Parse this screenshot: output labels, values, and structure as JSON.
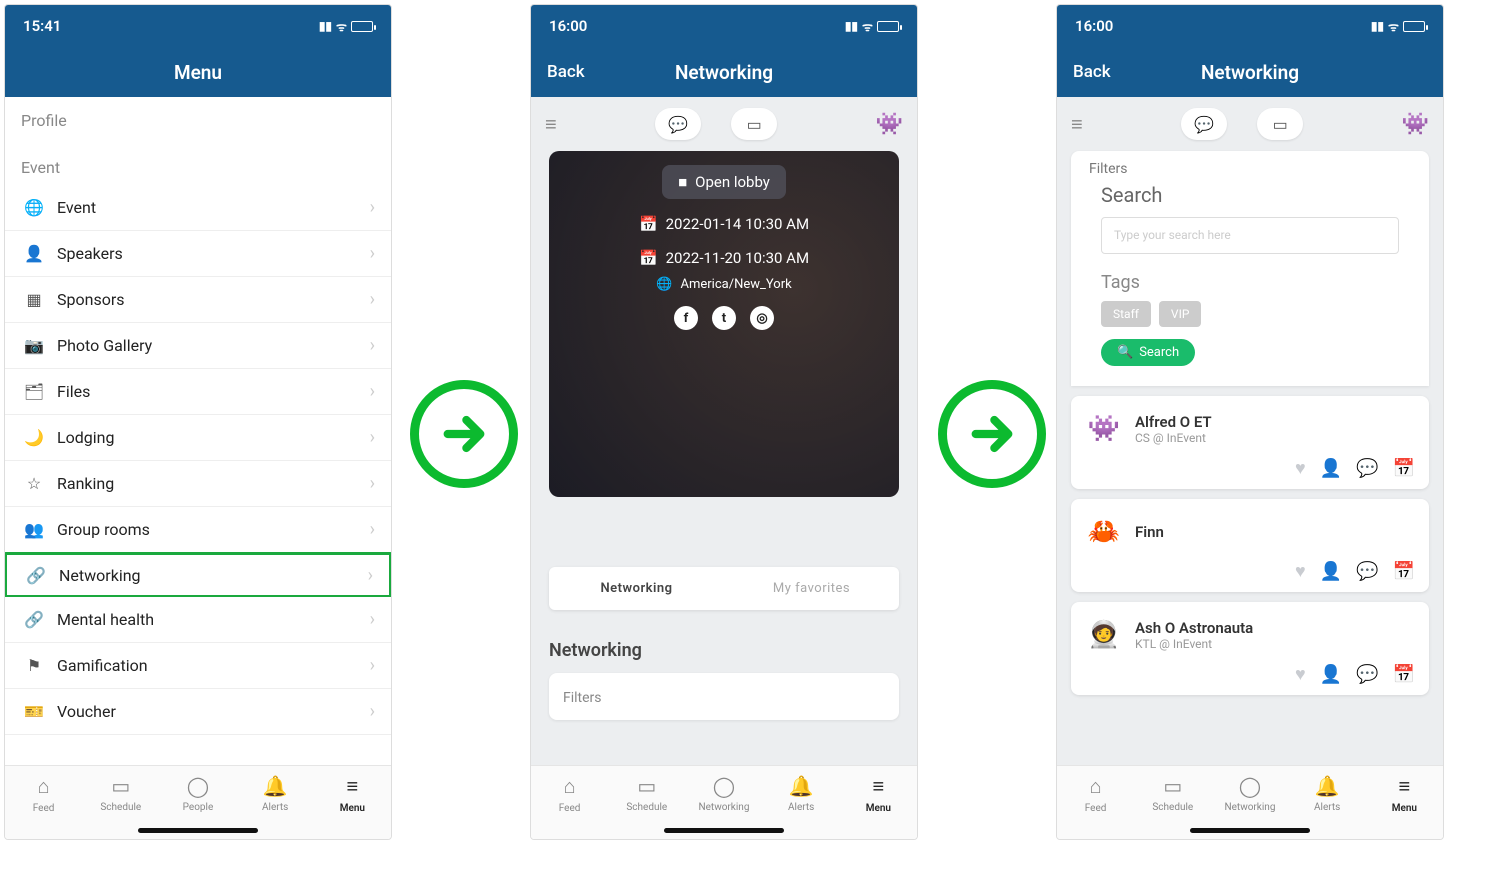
{
  "screen1": {
    "time": "15:41",
    "title": "Menu",
    "sections": {
      "profile": "Profile",
      "event": "Event"
    },
    "items": [
      {
        "icon": "globe-icon",
        "glyph": "🌐",
        "label": "Event"
      },
      {
        "icon": "speaker-icon",
        "glyph": "👤",
        "label": "Speakers"
      },
      {
        "icon": "sponsors-icon",
        "glyph": "▦",
        "label": "Sponsors"
      },
      {
        "icon": "camera-icon",
        "glyph": "📷",
        "label": "Photo Gallery"
      },
      {
        "icon": "files-icon",
        "glyph": "🗂",
        "label": "Files"
      },
      {
        "icon": "moon-icon",
        "glyph": "🌙",
        "label": "Lodging"
      },
      {
        "icon": "star-icon",
        "glyph": "☆",
        "label": "Ranking"
      },
      {
        "icon": "group-icon",
        "glyph": "👥",
        "label": "Group rooms"
      },
      {
        "icon": "link-icon",
        "glyph": "🔗",
        "label": "Networking",
        "highlight": true
      },
      {
        "icon": "link-icon",
        "glyph": "🔗",
        "label": "Mental health"
      },
      {
        "icon": "flag-icon",
        "glyph": "⚑",
        "label": "Gamification"
      },
      {
        "icon": "ticket-icon",
        "glyph": "🎫",
        "label": "Voucher"
      }
    ],
    "tabs": [
      {
        "icon": "⌂",
        "label": "Feed"
      },
      {
        "icon": "▭",
        "label": "Schedule"
      },
      {
        "icon": "◯",
        "label": "People"
      },
      {
        "icon": "🔔",
        "label": "Alerts"
      },
      {
        "icon": "≡",
        "label": "Menu",
        "active": true
      }
    ]
  },
  "screen2": {
    "time": "16:00",
    "back": "Back",
    "title": "Networking",
    "lobby_label": "Open lobby",
    "date1": "2022-01-14 10:30 AM",
    "date2": "2022-11-20 10:30 AM",
    "timezone": "America/New_York",
    "segments": {
      "networking": "Networking",
      "favorites": "My favorites"
    },
    "section_title": "Networking",
    "filters_label": "Filters",
    "tabs": [
      {
        "icon": "⌂",
        "label": "Feed"
      },
      {
        "icon": "▭",
        "label": "Schedule"
      },
      {
        "icon": "◯",
        "label": "Networking"
      },
      {
        "icon": "🔔",
        "label": "Alerts"
      },
      {
        "icon": "≡",
        "label": "Menu",
        "active": true
      }
    ]
  },
  "screen3": {
    "time": "16:00",
    "back": "Back",
    "title": "Networking",
    "filters_label": "Filters",
    "search_label": "Search",
    "search_placeholder": "Type your search here",
    "tags_label": "Tags",
    "tags": [
      "Staff",
      "VIP"
    ],
    "search_btn": "Search",
    "people": [
      {
        "avatar": "👾",
        "name": "Alfred O ET",
        "role": "CS @ InEvent"
      },
      {
        "avatar": "🦀",
        "name": "Finn",
        "role": ""
      },
      {
        "avatar": "🧑‍🚀",
        "name": "Ash O Astronauta",
        "role": "KTL @ InEvent"
      }
    ],
    "tabs": [
      {
        "icon": "⌂",
        "label": "Feed"
      },
      {
        "icon": "▭",
        "label": "Schedule"
      },
      {
        "icon": "◯",
        "label": "Networking"
      },
      {
        "icon": "🔔",
        "label": "Alerts"
      },
      {
        "icon": "≡",
        "label": "Menu",
        "active": true
      }
    ]
  }
}
